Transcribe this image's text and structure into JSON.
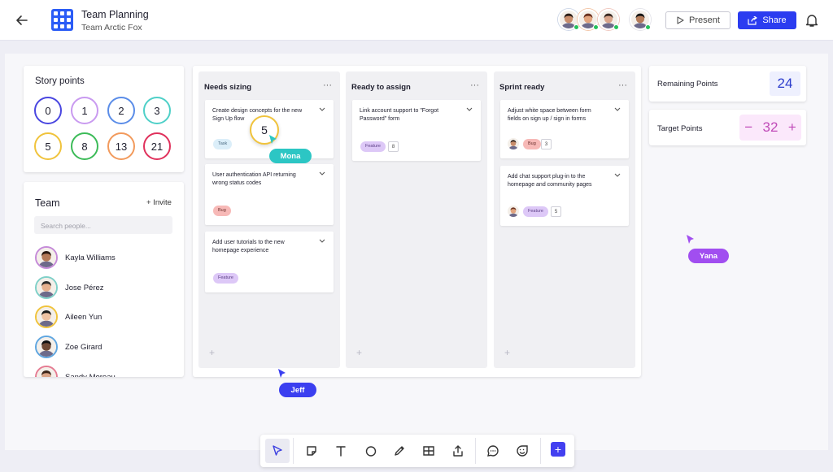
{
  "header": {
    "title": "Team Planning",
    "subtitle": "Team Arctic Fox",
    "present_label": "Present",
    "share_label": "Share",
    "icons": [
      "back-arrow-icon",
      "app-grid-logo",
      "present-icon",
      "share-icon",
      "bell-icon"
    ],
    "avatars": [
      {
        "skin": "#c98d6b",
        "hair": "#2c1e17",
        "ring": "#cfd8e8",
        "online": true
      },
      {
        "skin": "#e2a47e",
        "hair": "#6b3220",
        "ring": "#f3c6a8",
        "online": true
      },
      {
        "skin": "#d9a48a",
        "hair": "#3a2a22",
        "ring": "#f0c9c0",
        "online": true
      },
      {
        "skin": "#b57c5a",
        "hair": "#151515",
        "ring": "#e4e4ea",
        "online": true
      }
    ]
  },
  "story_points": {
    "title": "Story points",
    "values": [
      "0",
      "1",
      "2",
      "3",
      "5",
      "8",
      "13",
      "21"
    ],
    "colors": [
      "#4a47e0",
      "#c99af0",
      "#5b8de8",
      "#4fd0c8",
      "#f0c33c",
      "#3cbb58",
      "#f29a5c",
      "#e0315c"
    ]
  },
  "team": {
    "title": "Team",
    "invite_label": "+ Invite",
    "search_placeholder": "Search people...",
    "members": [
      {
        "name": "Kayla Williams",
        "ring": "#c58ad8",
        "skin": "#b47a58",
        "hair": "#2a1a12"
      },
      {
        "name": "Jose Pérez",
        "ring": "#7fd0c8",
        "skin": "#e6b08e",
        "hair": "#2c2c2c"
      },
      {
        "name": "Aileen Yun",
        "ring": "#f0c33c",
        "skin": "#efc2a2",
        "hair": "#1b1b1b"
      },
      {
        "name": "Zoe Girard",
        "ring": "#5fa6e0",
        "skin": "#6f4a35",
        "hair": "#111"
      },
      {
        "name": "Sandy Moreau",
        "ring": "#e57b92",
        "skin": "#d9a486",
        "hair": "#3a2418"
      }
    ]
  },
  "board": {
    "columns": [
      {
        "title": "Needs sizing",
        "more": "···",
        "add": "+",
        "cards": [
          {
            "text": "Create design concepts for the new Sign Up flow",
            "tag": "Task",
            "tag_type": "task",
            "points": ""
          },
          {
            "text": "User authentication API returning wrong status codes",
            "tag": "Bug",
            "tag_type": "bug",
            "points": ""
          },
          {
            "text": "Add user tutorials to the new homepage experience",
            "tag": "Feature",
            "tag_type": "feature",
            "points": ""
          }
        ]
      },
      {
        "title": "Ready to assign",
        "more": "···",
        "add": "+",
        "cards": [
          {
            "text": "Link account support to \"Forgot Password\" form",
            "tag": "Feature",
            "tag_type": "feature",
            "points": "8"
          }
        ]
      },
      {
        "title": "Sprint ready",
        "more": "···",
        "add": "+",
        "cards": [
          {
            "text": "Adjust white space between form fields on sign up / sign in forms",
            "tag": "Bug",
            "tag_type": "bug",
            "points": "3"
          },
          {
            "text": "Add chat support plug-in to the homepage and community pages",
            "tag": "Feature",
            "tag_type": "feature",
            "points": "5"
          }
        ]
      }
    ]
  },
  "metrics": {
    "remaining_label": "Remaining Points",
    "remaining_value": "24",
    "target_label": "Target Points",
    "target_value": "32",
    "minus": "−",
    "plus": "+"
  },
  "drag": {
    "value": "5"
  },
  "cursors": [
    {
      "name": "Mona",
      "color": "#2cc6c4"
    },
    {
      "name": "Jeff",
      "color": "#3b3ff0"
    },
    {
      "name": "Yana",
      "color": "#a14ef0"
    }
  ],
  "toolbar": {
    "tools": [
      "select-icon",
      "sticky-note-icon",
      "text-icon",
      "shape-icon",
      "pen-icon",
      "table-icon",
      "upload-icon",
      "comment-icon",
      "sticker-icon"
    ],
    "add_label": "+"
  }
}
